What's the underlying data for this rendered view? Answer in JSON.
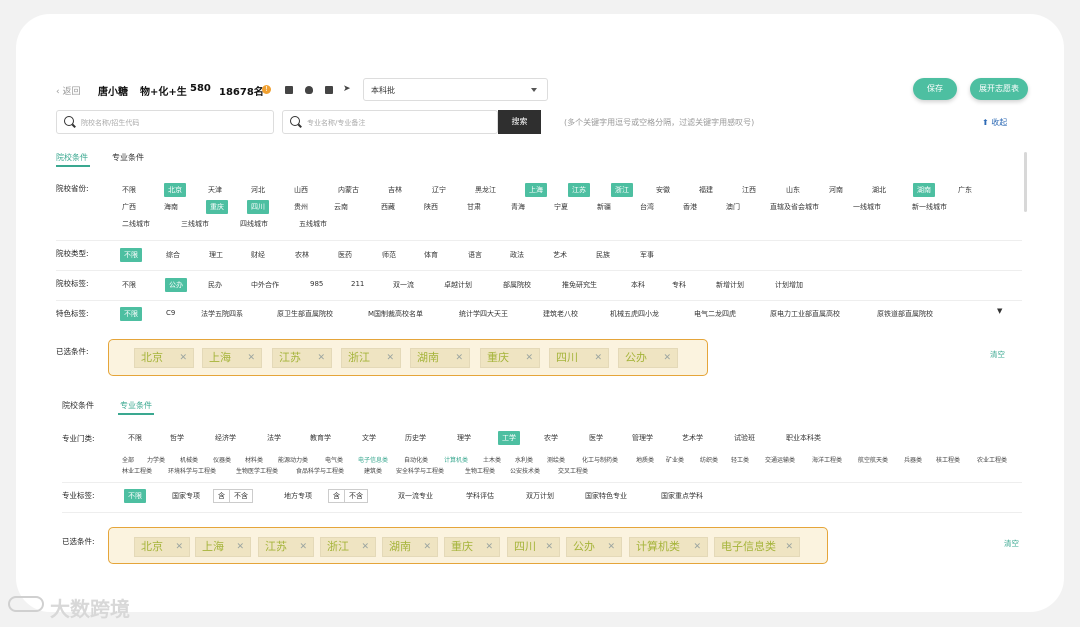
{
  "topbar": {
    "back": "返回",
    "user": "唐小糖",
    "subjects": "物+化+生",
    "score": "580",
    "rank": "18678名",
    "info": "!",
    "batch": "本科批",
    "save": "保存",
    "expand": "展开志愿表"
  },
  "search": {
    "school_placeholder": "院校名称/招生代码",
    "major_placeholder": "专业名称/专业备注",
    "button": "搜索",
    "hint": "(多个关键字用逗号或空格分隔，过滤关键字用感叹号)",
    "collapse": "收起"
  },
  "panel1": {
    "tabs": [
      "院校条件",
      "专业条件"
    ],
    "province_label": "院校省份:",
    "provinces_row1": [
      "不限",
      "北京",
      "天津",
      "河北",
      "山西",
      "内蒙古",
      "吉林",
      "辽宁",
      "黑龙江",
      "上海",
      "江苏",
      "浙江",
      "安徽",
      "福建",
      "江西",
      "山东",
      "河南",
      "湖北",
      "湖南",
      "广东"
    ],
    "provinces_row2": [
      "广西",
      "海南",
      "重庆",
      "四川",
      "贵州",
      "云南",
      "西藏",
      "陕西",
      "甘肃",
      "青海",
      "宁夏",
      "新疆",
      "台湾",
      "香港",
      "澳门",
      "直辖及省会城市",
      "一线城市",
      "新一线城市"
    ],
    "provinces_row3": [
      "二线城市",
      "三线城市",
      "四线城市",
      "五线城市"
    ],
    "type_label": "院校类型:",
    "types": [
      "不限",
      "综合",
      "理工",
      "财经",
      "农林",
      "医药",
      "师范",
      "体育",
      "语言",
      "政法",
      "艺术",
      "民族",
      "军事"
    ],
    "tag_label": "院校标签:",
    "tags": [
      "不限",
      "公办",
      "民办",
      "中外合作",
      "985",
      "211",
      "双一流",
      "卓越计划",
      "部属院校",
      "推免研究生",
      "本科",
      "专科",
      "新增计划",
      "计划增加"
    ],
    "feature_label": "特色标签:",
    "features": [
      "不限",
      "C9",
      "法学五院四系",
      "原卫生部直属院校",
      "M国制裁高校名单",
      "统计学四大天王",
      "建筑老八校",
      "机械五虎四小龙",
      "电气二龙四虎",
      "原电力工业部直属高校",
      "原铁道部直属院校"
    ],
    "selected_label": "已选条件:",
    "selected": [
      "北京",
      "上海",
      "江苏",
      "浙江",
      "湖南",
      "重庆",
      "四川",
      "公办"
    ],
    "clear": "清空"
  },
  "panel2": {
    "tabs": [
      "院校条件",
      "专业条件"
    ],
    "category_label": "专业门类:",
    "categories": [
      "不限",
      "哲学",
      "经济学",
      "法学",
      "教育学",
      "文学",
      "历史学",
      "理学",
      "工学",
      "农学",
      "医学",
      "管理学",
      "艺术学",
      "试验班",
      "职业本科类"
    ],
    "sub_row1": [
      "全部",
      "力学类",
      "机械类",
      "仪器类",
      "材料类",
      "能源动力类",
      "电气类",
      "电子信息类",
      "自动化类",
      "计算机类",
      "土木类",
      "水利类",
      "测绘类",
      "化工与制药类",
      "地质类",
      "矿业类",
      "纺织类",
      "轻工类",
      "交通运输类",
      "海洋工程类",
      "航空航天类",
      "兵器类",
      "核工程类",
      "农业工程类"
    ],
    "sub_row2": [
      "林业工程类",
      "环境科学与工程类",
      "生物医学工程类",
      "食品科学与工程类",
      "建筑类",
      "安全科学与工程类",
      "生物工程类",
      "公安技术类",
      "交叉工程类"
    ],
    "majortag_label": "专业标签:",
    "majortags_all": "不限",
    "national": "国家专项",
    "local": "地方专项",
    "include": "含",
    "exclude": "不含",
    "majortags_rest": [
      "双一流专业",
      "学科评估",
      "双万计划",
      "国家特色专业",
      "国家重点学科"
    ],
    "selected_label": "已选条件:",
    "selected": [
      "北京",
      "上海",
      "江苏",
      "浙江",
      "湖南",
      "重庆",
      "四川",
      "公办",
      "计算机类",
      "电子信息类"
    ],
    "clear": "清空"
  },
  "watermark": "大数跨境",
  "colors": {
    "accent": "#4dbfa1",
    "highlight_border": "#e5a53a",
    "chip_text": "#a5b43a"
  }
}
